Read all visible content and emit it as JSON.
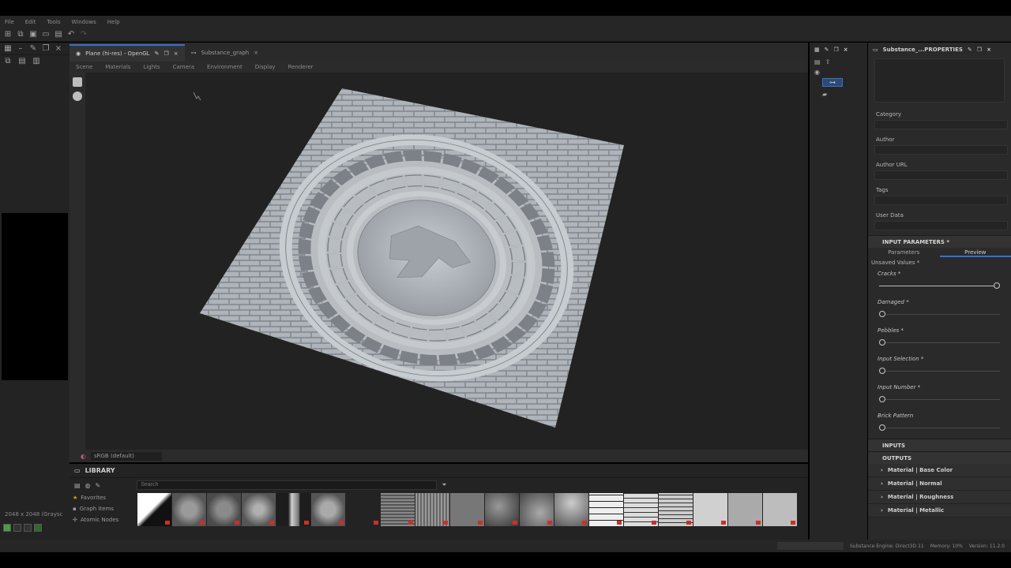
{
  "menu": [
    "File",
    "Edit",
    "Tools",
    "Windows",
    "Help"
  ],
  "left_panel": {
    "res_info": "2048 x 2048 (Graysc"
  },
  "viewport": {
    "tabs": [
      {
        "label": "Plane (hi-res) - OpenGL",
        "active": true
      },
      {
        "label": "Substance_graph",
        "active": false
      }
    ],
    "menu": [
      "Scene",
      "Materials",
      "Lights",
      "Camera",
      "Environment",
      "Display",
      "Renderer"
    ],
    "colorspace": "sRGB (default)"
  },
  "library": {
    "title": "LIBRARY",
    "search_placeholder": "Search",
    "categories": [
      "Favorites",
      "Graph Items",
      "Atomic Nodes"
    ]
  },
  "properties": {
    "title": "Substance_...PROPERTIES",
    "fields": [
      "Category",
      "Author",
      "Author URL",
      "Tags",
      "User Data"
    ],
    "input_parameters_title": "INPUT PARAMETERS *",
    "subtabs": [
      "Parameters",
      "Preview"
    ],
    "unsaved": "Unsaved Values *",
    "params": [
      {
        "label": "Cracks *",
        "value": 1.0
      },
      {
        "label": "Damaged *",
        "value": 0.0
      },
      {
        "label": "Pebbles *",
        "value": 0.0
      },
      {
        "label": "Input Selection *",
        "value": 0.0
      },
      {
        "label": "Input Number *",
        "value": 0.0
      },
      {
        "label": "Brick Pattern",
        "value": 0.0
      }
    ],
    "inputs_title": "INPUTS",
    "outputs_title": "OUTPUTS",
    "outputs": [
      "Material | Base Color",
      "Material | Normal",
      "Material | Roughness",
      "Material | Metallic"
    ]
  },
  "status": {
    "engine": "Substance Engine: Direct3D 11",
    "memory": "Memory: 10%",
    "version": "Version: 11.2.0"
  }
}
